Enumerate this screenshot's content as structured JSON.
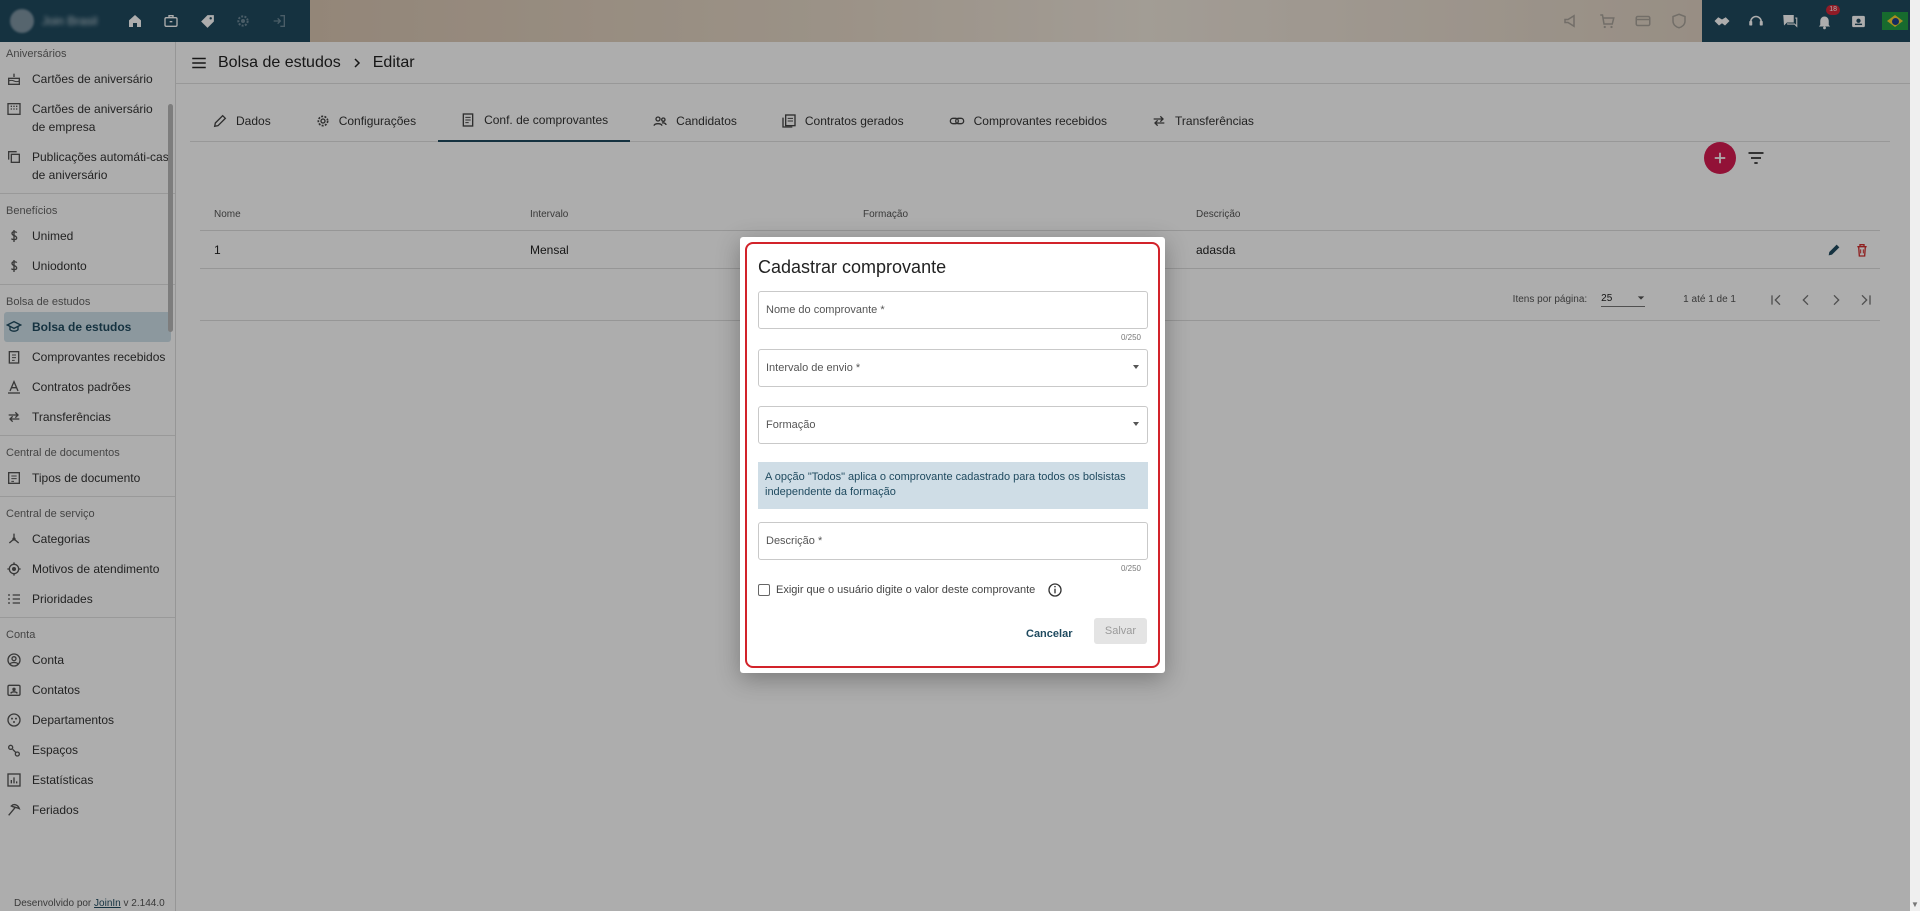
{
  "topbar": {
    "company_name": "Join Brasil",
    "notifications_count": "18"
  },
  "sidebar": {
    "sections": [
      {
        "title": "Aniversários",
        "items": [
          {
            "label": "Cartões de aniversário",
            "icon": "cake-icon"
          },
          {
            "label": "Cartões de aniversário de empresa",
            "icon": "building-icon"
          },
          {
            "label": "Publicações automáti-cas de aniversário",
            "icon": "copy-icon"
          }
        ]
      },
      {
        "title": "Benefícios",
        "items": [
          {
            "label": "Unimed",
            "icon": "dollar-icon"
          },
          {
            "label": "Uniodonto",
            "icon": "dollar-icon"
          }
        ]
      },
      {
        "title": "Bolsa de estudos",
        "items": [
          {
            "label": "Bolsa de estudos",
            "icon": "graduation-icon",
            "active": true
          },
          {
            "label": "Comprovantes recebidos",
            "icon": "clipboard-icon"
          },
          {
            "label": "Contratos padrões",
            "icon": "font-icon"
          },
          {
            "label": "Transferências",
            "icon": "transfer-icon"
          }
        ]
      },
      {
        "title": "Central de documentos",
        "items": [
          {
            "label": "Tipos de documento",
            "icon": "document-types-icon"
          }
        ]
      },
      {
        "title": "Central de serviço",
        "items": [
          {
            "label": "Categorias",
            "icon": "hub-icon"
          },
          {
            "label": "Motivos de atendimento",
            "icon": "target-icon"
          },
          {
            "label": "Prioridades",
            "icon": "priority-list-icon"
          }
        ]
      },
      {
        "title": "Conta",
        "items": [
          {
            "label": "Conta",
            "icon": "account-icon"
          },
          {
            "label": "Contatos",
            "icon": "contacts-icon"
          },
          {
            "label": "Departamentos",
            "icon": "departments-icon"
          },
          {
            "label": "Espaços",
            "icon": "spaces-icon"
          },
          {
            "label": "Estatísticas",
            "icon": "stats-icon"
          },
          {
            "label": "Feriados",
            "icon": "holiday-icon"
          }
        ]
      }
    ],
    "footer_prefix": "Desenvolvido por",
    "footer_link": "JoinIn",
    "footer_version": "v 2.144.0"
  },
  "breadcrumb": {
    "root": "Bolsa de estudos",
    "current": "Editar"
  },
  "tabs": [
    {
      "label": "Dados",
      "icon": "pencil-icon"
    },
    {
      "label": "Configurações",
      "icon": "gear-icon"
    },
    {
      "label": "Conf. de comprovantes",
      "icon": "receipt-icon",
      "active": true
    },
    {
      "label": "Candidatos",
      "icon": "people-icon"
    },
    {
      "label": "Contratos gerados",
      "icon": "contracts-icon"
    },
    {
      "label": "Comprovantes recebidos",
      "icon": "link-icon"
    },
    {
      "label": "Transferências",
      "icon": "transfer-icon"
    }
  ],
  "table": {
    "headers": [
      "Nome",
      "Intervalo",
      "Formação",
      "Descrição"
    ],
    "rows": [
      {
        "nome": "1",
        "intervalo": "Mensal",
        "formacao": "",
        "descricao": "adasda"
      }
    ]
  },
  "pager": {
    "items_per_page_label": "Itens por página:",
    "items_per_page_value": "25",
    "range": "1 até 1 de 1"
  },
  "dialog": {
    "title": "Cadastrar comprovante",
    "name_label": "Nome do comprovante *",
    "name_counter": "0/250",
    "interval_label": "Intervalo de envio *",
    "formation_label": "Formação",
    "notice": "A opção \"Todos\" aplica o comprovante cadastrado para todos os bolsistas independente da formação",
    "description_label": "Descrição *",
    "description_counter": "0/250",
    "checkbox_label": "Exigir que o usuário digite o valor deste comprovante",
    "cancel_label": "Cancelar",
    "save_label": "Salvar"
  },
  "colors": {
    "primary": "#1f4a5f",
    "fab": "#d81b52",
    "delete": "#d32f2f",
    "dialog_outline": "#d2232a",
    "notice_bg": "#cfdde6"
  }
}
